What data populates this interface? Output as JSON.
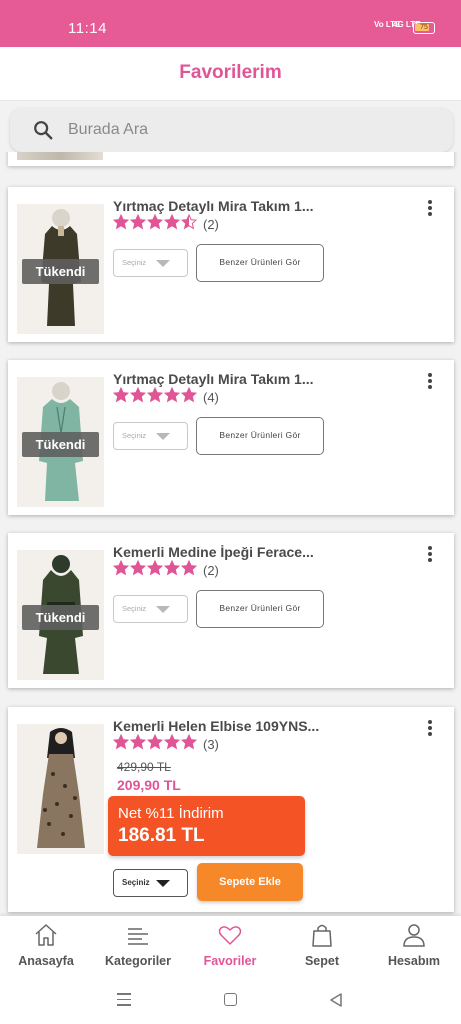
{
  "status_bar": {
    "time": "11:14",
    "network_1": "Vo LTE",
    "network_2": "4G LTE",
    "battery": "75"
  },
  "header": {
    "title": "Favorilerim"
  },
  "search": {
    "placeholder": "Burada Ara"
  },
  "colors": {
    "brand_pink": "#e65a96",
    "title_pink": "#e05596",
    "promo_orange": "#f45325",
    "cart_orange": "#f7882a",
    "star_pink": "#e05596"
  },
  "items": [
    {
      "name": "Yırtmaç Detaylı Mira Takım 1...",
      "rating": 4.5,
      "review_count": "(2)",
      "sold_out_label": "Tükendi",
      "select_label": "Seçiniz",
      "similar_label": "Benzer Ürünleri Gör"
    },
    {
      "name": "Yırtmaç Detaylı Mira Takım 1...",
      "rating": 5,
      "review_count": "(4)",
      "sold_out_label": "Tükendi",
      "select_label": "Seçiniz",
      "similar_label": "Benzer Ürünleri Gör"
    },
    {
      "name": "Kemerli Medine İpeği Ferace...",
      "rating": 5,
      "review_count": "(2)",
      "sold_out_label": "Tükendi",
      "select_label": "Seçiniz",
      "similar_label": "Benzer Ürünleri Gör"
    },
    {
      "name": "Kemerli Helen Elbise 109YNS...",
      "rating": 5,
      "review_count": "(3)",
      "old_price": "429,90 TL",
      "price": "209,90 TL",
      "promo_label": "Net %11 İndirim",
      "promo_price": "186.81 TL",
      "select_label": "Seçiniz",
      "cart_label": "Sepete Ekle"
    }
  ],
  "tabs": [
    {
      "label": "Anasayfa",
      "icon": "home-icon",
      "active": false
    },
    {
      "label": "Kategoriler",
      "icon": "categories-icon",
      "active": false
    },
    {
      "label": "Favoriler",
      "icon": "heart-icon",
      "active": true
    },
    {
      "label": "Sepet",
      "icon": "bag-icon",
      "active": false
    },
    {
      "label": "Hesabım",
      "icon": "user-icon",
      "active": false
    }
  ]
}
